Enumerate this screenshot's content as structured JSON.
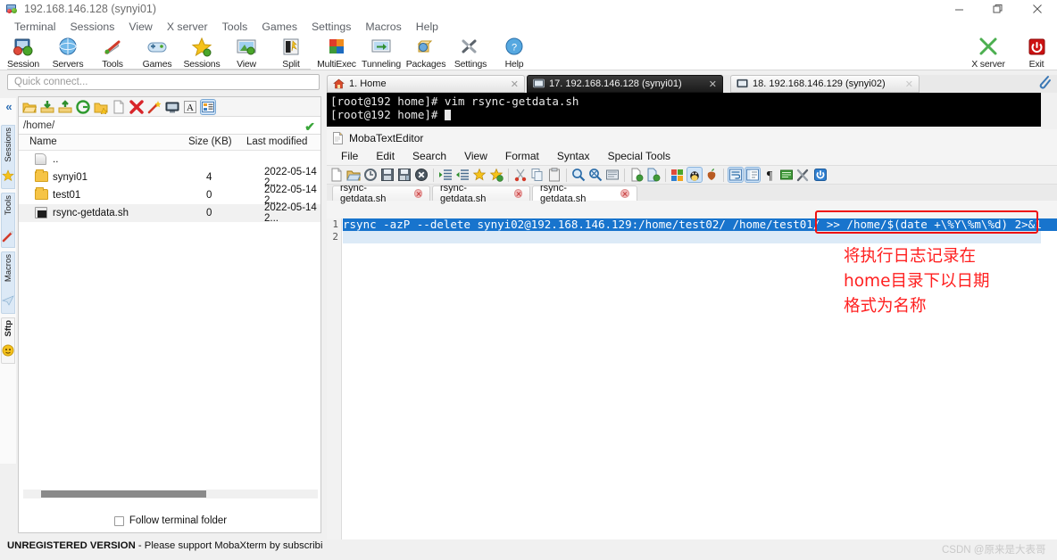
{
  "window": {
    "title": "192.168.146.128 (synyi01)",
    "icon": "moba-app-icon",
    "controls": {
      "minimize": "minimize-icon",
      "restore": "restore-icon",
      "close": "close-icon"
    }
  },
  "menubar": {
    "items": [
      "Terminal",
      "Sessions",
      "View",
      "X server",
      "Tools",
      "Games",
      "Settings",
      "Macros",
      "Help"
    ]
  },
  "toolbar": {
    "items": [
      {
        "label": "Session",
        "icon": "session-icon"
      },
      {
        "label": "Servers",
        "icon": "servers-icon"
      },
      {
        "label": "Tools",
        "icon": "tools-icon"
      },
      {
        "label": "Games",
        "icon": "games-icon"
      },
      {
        "label": "Sessions",
        "icon": "sessions-star-icon"
      },
      {
        "label": "View",
        "icon": "view-icon"
      },
      {
        "label": "Split",
        "icon": "split-icon"
      },
      {
        "label": "MultiExec",
        "icon": "multiexec-icon"
      },
      {
        "label": "Tunneling",
        "icon": "tunneling-icon"
      },
      {
        "label": "Packages",
        "icon": "packages-icon"
      },
      {
        "label": "Settings",
        "icon": "settings-icon"
      },
      {
        "label": "Help",
        "icon": "help-icon"
      }
    ],
    "right": [
      {
        "label": "X server",
        "icon": "x-server-icon"
      },
      {
        "label": "Exit",
        "icon": "exit-icon"
      }
    ]
  },
  "quick_connect": {
    "placeholder": "Quick connect..."
  },
  "rail": {
    "collapse": "double-chevron-left-icon",
    "tabs": [
      {
        "label": "Sessions",
        "icon": "star-icon",
        "active": false
      },
      {
        "label": "Tools",
        "icon": "magic-wand-icon",
        "active": false
      },
      {
        "label": "Macros",
        "icon": "paper-plane-icon",
        "active": false
      },
      {
        "label": "Sftp",
        "icon": "smiley-icon",
        "active": true
      }
    ]
  },
  "sftp": {
    "tool_icons": [
      "open-folder-icon",
      "download-icon",
      "upload-icon",
      "refresh-icon",
      "new-folder-icon",
      "new-file-icon",
      "delete-icon",
      "permissions-icon",
      "terminal-icon",
      "text-mode-icon",
      "list-view-icon"
    ],
    "path": "/home/",
    "path_status": "ok-check-icon",
    "columns": [
      "Name",
      "Size (KB)",
      "Last modified"
    ],
    "rows": [
      {
        "name": "..",
        "size": "",
        "modified": "",
        "icon": "parent-folder-icon"
      },
      {
        "name": "synyi01",
        "size": "4",
        "modified": "2022-05-14 2...",
        "icon": "folder-icon"
      },
      {
        "name": "test01",
        "size": "0",
        "modified": "2022-05-14 2...",
        "icon": "folder-icon"
      },
      {
        "name": "rsync-getdata.sh",
        "size": "0",
        "modified": "2022-05-14 2...",
        "icon": "script-file-icon"
      }
    ],
    "follow_label": "Follow terminal folder",
    "follow_checked": false
  },
  "status": {
    "unregistered_bold": "UNREGISTERED VERSION",
    "unregistered_rest": "-  Please support MobaXterm by subscribi"
  },
  "terminal": {
    "tabs": [
      {
        "label": "1. Home",
        "icon": "home-icon",
        "style": "light",
        "closable": true
      },
      {
        "label": "17. 192.168.146.128 (synyi01)",
        "icon": "terminal-icon",
        "style": "dark",
        "closable": true
      },
      {
        "label": "18. 192.168.146.129 (synyi02)",
        "icon": "terminal-icon",
        "style": "light",
        "closable": true
      }
    ],
    "new_tab": "new-tab-icon",
    "clipboard_icon": "clipboard-icon",
    "lines": [
      "[root@192 home]# vim rsync-getdata.sh",
      "[root@192 home]# "
    ]
  },
  "editor": {
    "title": "MobaTextEditor",
    "title_icon": "text-editor-icon",
    "menu": [
      "File",
      "Edit",
      "Search",
      "View",
      "Format",
      "Syntax",
      "Special Tools"
    ],
    "tool_icons": [
      "new-file-icon",
      "open-file-icon",
      "reload-icon",
      "save-icon",
      "save-as-icon",
      "close-file-icon",
      "indent-icon",
      "outdent-icon",
      "bookmark-icon",
      "add-bookmark-icon",
      "cut-icon",
      "copy-icon",
      "paste-icon",
      "find-icon",
      "find-replace-icon",
      "goto-icon",
      "compare-icon",
      "merge-icon",
      "windows-format-icon",
      "unix-format-icon",
      "mac-format-icon",
      "wrap-icon",
      "linenumbers-icon",
      "pilcrow-icon",
      "syntax-icon",
      "tools-icon",
      "refresh-session-icon"
    ],
    "tabs": [
      {
        "label": "rsync-getdata.sh",
        "active": false
      },
      {
        "label": "rsync-getdata.sh",
        "active": false
      },
      {
        "label": "rsync-getdata.sh",
        "active": true
      }
    ],
    "gutter": [
      "1",
      "2"
    ],
    "code_line_1": "rsync -azP --delete synyi02@192.168.146.129:/home/test02/ /home/test01/ >> /home/$(date +\\%Y\\%m\\%d) 2>&1",
    "code_line_2": ""
  },
  "annotation": {
    "text": "将执行日志记录在home目录下以日期格式为名称",
    "lines": [
      "将执行日志记录在",
      "home目录下以日期",
      "格式为名称"
    ],
    "color": "#ff2020",
    "highlight_box_color": "#ee1111"
  },
  "watermark": {
    "text": "CSDN @原来是大表哥"
  },
  "colors": {
    "accent": "#1874cd",
    "terminal_bg": "#000000",
    "terminal_fg": "#e9e9e9",
    "annotation_red": "#ff2020",
    "exit_red": "#cc1111",
    "xserver_green": "#4caf50"
  }
}
